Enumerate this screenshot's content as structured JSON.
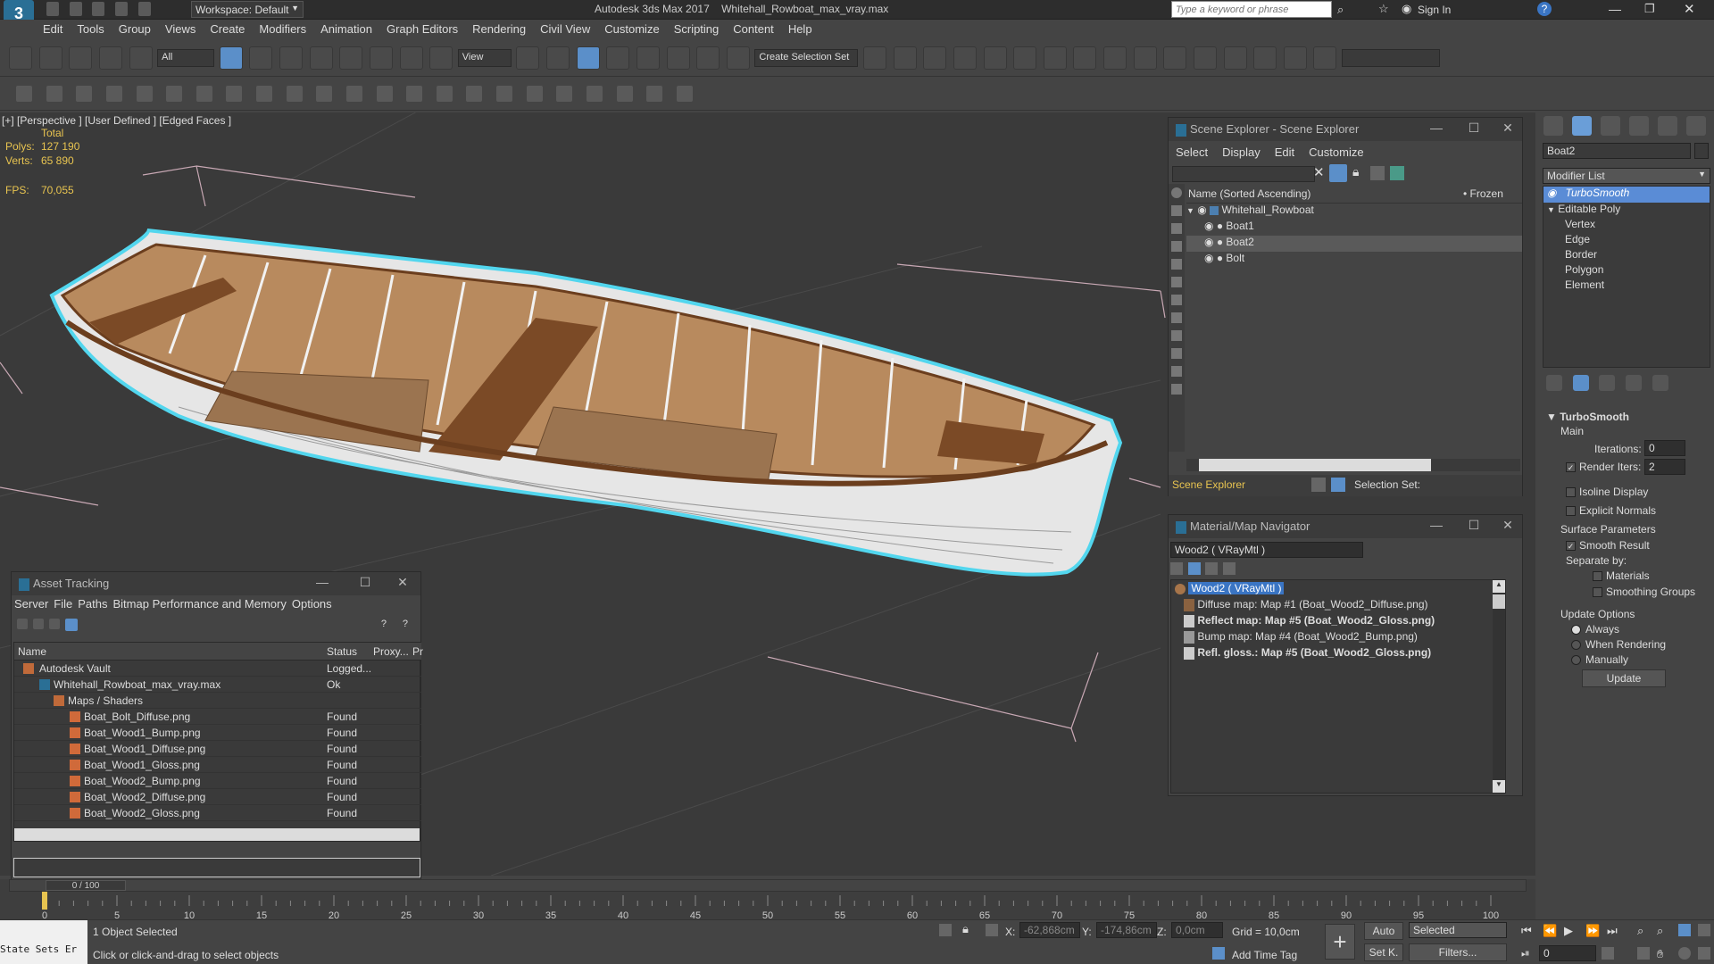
{
  "title": {
    "app": "Autodesk 3ds Max 2017",
    "file": "Whitehall_Rowboat_max_vray.max",
    "workspace": "Workspace: Default",
    "search_placeholder": "Type a keyword or phrase",
    "sign_in": "Sign In"
  },
  "menus": [
    "Edit",
    "Tools",
    "Group",
    "Views",
    "Create",
    "Modifiers",
    "Animation",
    "Graph Editors",
    "Rendering",
    "Civil View",
    "Customize",
    "Scripting",
    "Content",
    "Help"
  ],
  "toolbar": {
    "filter": "All",
    "view": "View",
    "create_selection_set": "Create Selection Set"
  },
  "viewport": {
    "label": "[+] [Perspective ] [User Defined ] [Edged Faces ]",
    "total": "Total",
    "polys_label": "Polys:",
    "polys": "127 190",
    "verts_label": "Verts:",
    "verts": "65 890",
    "fps_label": "FPS:",
    "fps": "70,055"
  },
  "scene_explorer": {
    "title": "Scene Explorer - Scene Explorer",
    "menu": [
      "Select",
      "Display",
      "Edit",
      "Customize"
    ],
    "col_name": "Name (Sorted Ascending)",
    "col_frozen": "Frozen",
    "items": [
      "Whitehall_Rowboat",
      "Boat1",
      "Boat2",
      "Bolt"
    ],
    "footer": "Scene Explorer",
    "selection_set": "Selection Set:"
  },
  "material_nav": {
    "title": "Material/Map Navigator",
    "field": "Wood2  ( VRayMtl )",
    "root": "Wood2  ( VRayMtl )",
    "maps": [
      "Diffuse map: Map #1 (Boat_Wood2_Diffuse.png)",
      "Reflect map: Map #5 (Boat_Wood2_Gloss.png)",
      "Bump map: Map #4 (Boat_Wood2_Bump.png)",
      "Refl. gloss.: Map #5 (Boat_Wood2_Gloss.png)"
    ]
  },
  "asset_tracking": {
    "title": "Asset Tracking",
    "menu": [
      "Server",
      "File",
      "Paths",
      "Bitmap Performance and Memory",
      "Options"
    ],
    "cols": [
      "Name",
      "Status",
      "Proxy...",
      "Pr"
    ],
    "rows": [
      {
        "name": "Autodesk Vault",
        "status": "Logged..."
      },
      {
        "name": "Whitehall_Rowboat_max_vray.max",
        "status": "Ok"
      },
      {
        "name": "Maps / Shaders",
        "status": ""
      },
      {
        "name": "Boat_Bolt_Diffuse.png",
        "status": "Found"
      },
      {
        "name": "Boat_Wood1_Bump.png",
        "status": "Found"
      },
      {
        "name": "Boat_Wood1_Diffuse.png",
        "status": "Found"
      },
      {
        "name": "Boat_Wood1_Gloss.png",
        "status": "Found"
      },
      {
        "name": "Boat_Wood2_Bump.png",
        "status": "Found"
      },
      {
        "name": "Boat_Wood2_Diffuse.png",
        "status": "Found"
      },
      {
        "name": "Boat_Wood2_Gloss.png",
        "status": "Found"
      }
    ]
  },
  "command_panel": {
    "object_name": "Boat2",
    "modifier_list": "Modifier List",
    "stack": [
      "TurboSmooth",
      "Editable Poly",
      "Vertex",
      "Edge",
      "Border",
      "Polygon",
      "Element"
    ],
    "rollout": "TurboSmooth",
    "main": "Main",
    "iterations_label": "Iterations:",
    "iterations": "0",
    "render_iters_label": "Render Iters:",
    "render_iters": "2",
    "isoline": "Isoline Display",
    "explicit": "Explicit Normals",
    "surface": "Surface Parameters",
    "smooth_result": "Smooth Result",
    "separate": "Separate by:",
    "materials": "Materials",
    "smoothing": "Smoothing Groups",
    "update_options": "Update Options",
    "always": "Always",
    "when_rendering": "When Rendering",
    "manually": "Manually",
    "update": "Update"
  },
  "timeline": {
    "frame": "0 / 100",
    "ticks": [
      "0",
      "5",
      "10",
      "15",
      "20",
      "25",
      "30",
      "35",
      "40",
      "45",
      "50",
      "55",
      "60",
      "65",
      "70",
      "75",
      "80",
      "85",
      "90",
      "95",
      "100"
    ]
  },
  "status": {
    "maxscript": "State Sets Er",
    "selected": "1 Object Selected",
    "prompt": "Click or click-and-drag to select objects",
    "x_label": "X:",
    "x": "-62,868cm",
    "y_label": "Y:",
    "y": "-174,86cm",
    "z_label": "Z:",
    "z": "0,0cm",
    "grid": "Grid = 10,0cm",
    "add_time_tag": "Add Time Tag",
    "auto": "Auto",
    "set_k": "Set K.",
    "key_mode": "Selected",
    "filters": "Filters...",
    "frame_field": "0"
  }
}
